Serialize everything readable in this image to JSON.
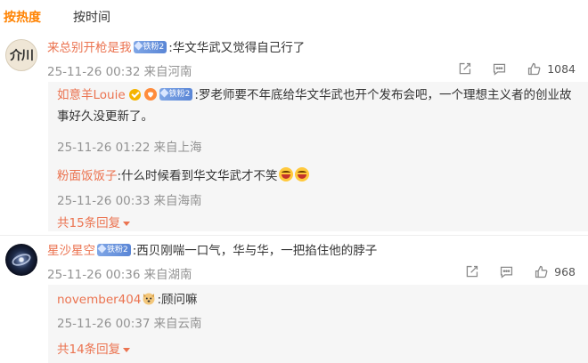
{
  "sort_tabs": {
    "hot": "按热度",
    "time": "按时间"
  },
  "colors": {
    "accent": "#ff8200",
    "username": "#eb7350",
    "meta": "#939393",
    "reply_bg": "#f6f6f6"
  },
  "comments": [
    {
      "avatar_text": "介川",
      "user": "来总别开枪是我",
      "badge": "铁粉2",
      "text": ":华文华武又觉得自己行了",
      "time": "25-11-26 00:32",
      "location": "来自河南",
      "likes": "1084",
      "replies": [
        {
          "user": "如意羊Louie",
          "badge": "铁粉2",
          "text": ":罗老师要不年底给华文华武也开个发布会吧，一个理想主义者的创业故事好久没更新了。",
          "time": "25-11-26 01:22",
          "location": "来自上海"
        },
        {
          "user": "粉面饭饭子",
          "text": ":什么时候看到华文华武才不笑",
          "time": "25-11-26 00:33",
          "location": "来自海南"
        }
      ],
      "more_replies": "共15条回复"
    },
    {
      "user": "星沙星空",
      "badge": "铁粉2",
      "text": ":西贝刚喘一口气，华与华，一把掐住他的脖子",
      "time": "25-11-26 00:36",
      "location": "来自湖南",
      "likes": "968",
      "replies": [
        {
          "user": "november404",
          "text": ":顾问嘛",
          "time": "25-11-26 00:37",
          "location": "来自云南"
        }
      ],
      "more_replies": "共14条回复"
    }
  ],
  "icons": [
    "share-icon",
    "comment-icon",
    "like-icon",
    "verified-icon",
    "fan-badge-icon",
    "laugh-emoji-icon",
    "dog-emoji-icon"
  ]
}
